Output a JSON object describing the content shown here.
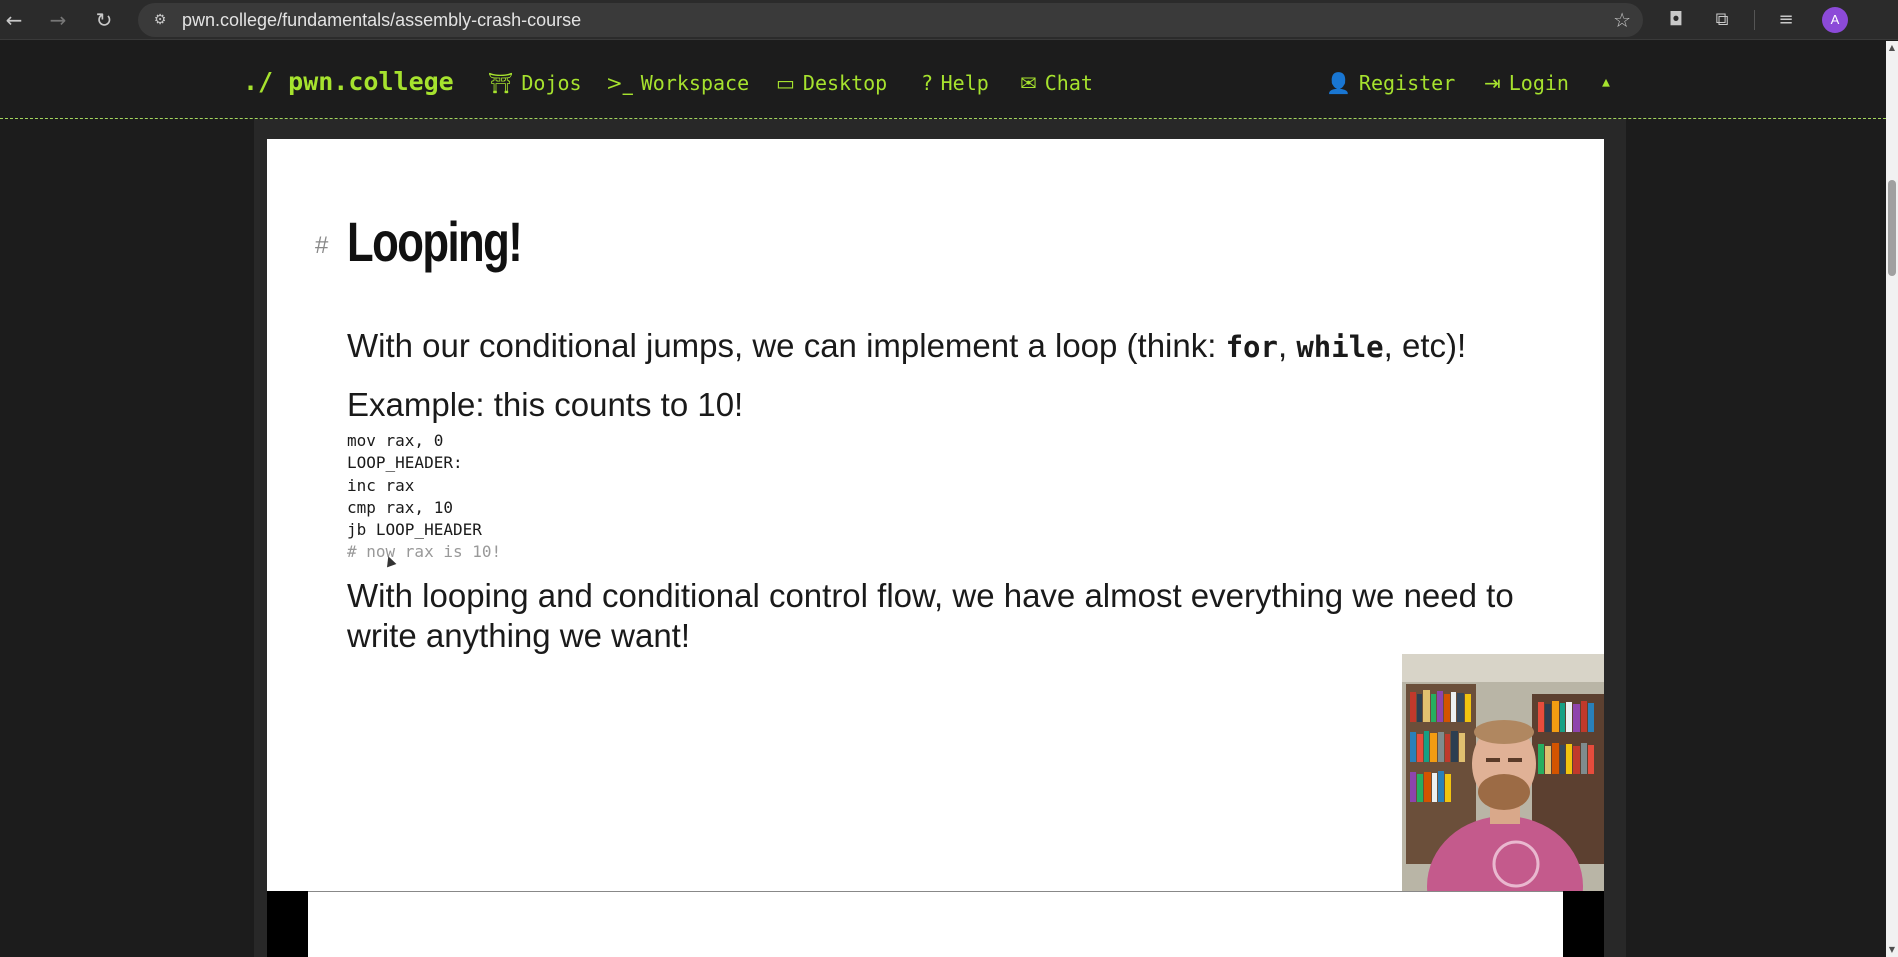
{
  "browser": {
    "url": "pwn.college/fundamentals/assembly-crash-course",
    "profile_initial": "A"
  },
  "nav": {
    "brand": "./ pwn.college",
    "items": [
      {
        "label": "Dojos",
        "icon": "torii-icon"
      },
      {
        "label": "Workspace",
        "icon": "terminal-icon"
      },
      {
        "label": "Desktop",
        "icon": "desktop-icon"
      },
      {
        "label": "Help",
        "icon": "question-icon"
      },
      {
        "label": "Chat",
        "icon": "comments-icon"
      }
    ],
    "register": "Register",
    "login": "Login",
    "accent": "#a6e22e"
  },
  "slide": {
    "hash": "#",
    "title": "Looping!",
    "intro_before": "With our conditional jumps, we can implement a loop (think: ",
    "kw1": "for",
    "sep": ", ",
    "kw2": "while",
    "intro_after": ", etc)!",
    "example": "Example: this counts to 10!",
    "code": [
      "mov rax, 0",
      "LOOP_HEADER:",
      "inc rax",
      "cmp rax, 10",
      "jb LOOP_HEADER"
    ],
    "code_comment": "# now rax is 10!",
    "closing": "With looping and conditional control flow, we have almost everything we need to write anything we want!"
  }
}
